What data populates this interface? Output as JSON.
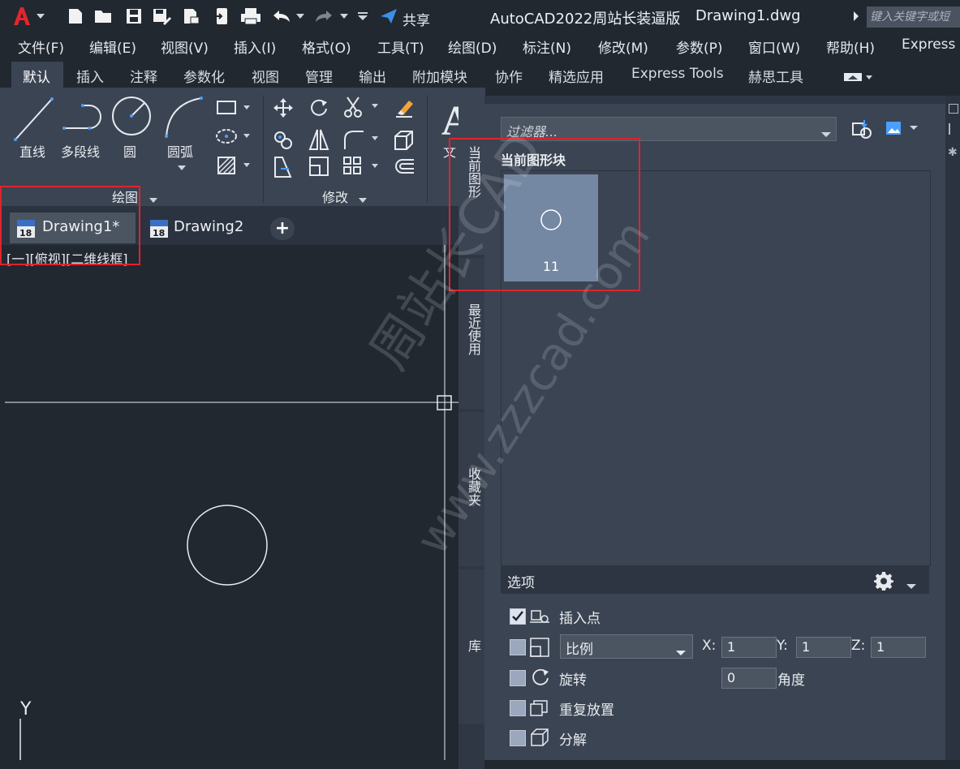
{
  "titlebar": {
    "share_label": "共享",
    "title": "AutoCAD2022周站长装逼版",
    "filename": "Drawing1.dwg",
    "search_placeholder": "键入关键字或短"
  },
  "menu": [
    "文件(F)",
    "编辑(E)",
    "视图(V)",
    "插入(I)",
    "格式(O)",
    "工具(T)",
    "绘图(D)",
    "标注(N)",
    "修改(M)",
    "参数(P)",
    "窗口(W)",
    "帮助(H)",
    "Express"
  ],
  "ribbon_tabs": [
    "默认",
    "插入",
    "注释",
    "参数化",
    "视图",
    "管理",
    "输出",
    "附加模块",
    "协作",
    "精选应用",
    "Express Tools",
    "赫思工具"
  ],
  "ribbon": {
    "draw_tools": [
      "直线",
      "多段线",
      "圆",
      "圆弧"
    ],
    "draw_panel": "绘图",
    "modify_panel": "修改",
    "text_label": "文"
  },
  "doc_tabs": {
    "tab1": "Drawing1*",
    "tab2": "Drawing2",
    "add": "+"
  },
  "viewport": {
    "controls": "[一][俯视][二维线框]",
    "ucs_y": "Y"
  },
  "palette": {
    "side_tabs": [
      "当前图形",
      "最近使用",
      "收藏夹",
      "库"
    ],
    "filter_placeholder": "过滤器...",
    "current_blocks_title": "当前图形块",
    "block_name": "11",
    "options_title": "选项",
    "insert_point": "插入点",
    "scale": "比例",
    "x_label": "X:",
    "y_label": "Y:",
    "z_label": "Z:",
    "x_val": "1",
    "y_val": "1",
    "z_val": "1",
    "rotate": "旋转",
    "angle_val": "0",
    "angle_label": "角度",
    "repeat": "重复放置",
    "explode": "分解"
  },
  "watermark": {
    "line1": "周站长CAD",
    "line2": "www.zzzcad.com"
  },
  "colors": {
    "highlight_red": "#e0232d",
    "thumb_bg": "#7488a3",
    "panel_bg": "#3b4453",
    "bg": "#212830"
  }
}
